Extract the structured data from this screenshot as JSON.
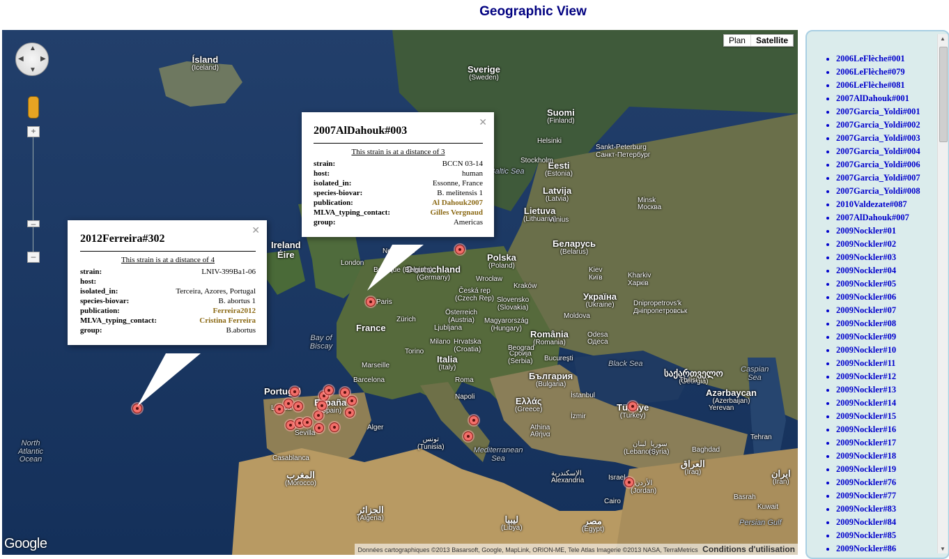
{
  "page": {
    "title": "Geographic View"
  },
  "map": {
    "type_controls": {
      "plan": "Plan",
      "satellite": "Satellite",
      "selected": "Satellite"
    },
    "logo": "Google",
    "attribution": "Données cartographiques ©2013 Basarsoft, Google, MapLink, ORION-ME, Tele Atlas Imagerie ©2013 NASA, TerraMetrics",
    "terms": "Conditions d'utilisation",
    "labels": {
      "iceland": {
        "name": "Ísland",
        "sub": "(Iceland)"
      },
      "sweden": {
        "name": "Sverige",
        "sub": "(Sweden)"
      },
      "finland": {
        "name": "Suomi",
        "sub": "(Finland)"
      },
      "estonia": {
        "name": "Eesti",
        "sub": "(Estonia)"
      },
      "latvia": {
        "name": "Latvija",
        "sub": "(Latvia)"
      },
      "lithuania": {
        "name": "Lietuva",
        "sub": "(Lithuania)"
      },
      "ireland": {
        "name": "Ireland",
        "sub": "Éire"
      },
      "poland": {
        "name": "Polska",
        "sub": "(Poland)"
      },
      "belarus": {
        "name": "Беларусь",
        "sub": "(Belarus)"
      },
      "germany": {
        "name": "Deutschland",
        "sub": "(Germany)"
      },
      "ukraine": {
        "name": "Україна",
        "sub": "(Ukraine)"
      },
      "czech": {
        "name": "Česká rep",
        "sub": "(Czech Rep)"
      },
      "slovakia": {
        "name": "Slovensko",
        "sub": "(Slovakia)"
      },
      "austria": {
        "name": "Österreich",
        "sub": "(Austria)"
      },
      "hungary": {
        "name": "Magyarország",
        "sub": "(Hungary)"
      },
      "moldova": {
        "name": "Moldova",
        "sub": ""
      },
      "france": {
        "name": "France",
        "sub": ""
      },
      "croatia": {
        "name": "Hrvatska",
        "sub": "(Croatia)"
      },
      "romania": {
        "name": "România",
        "sub": "(Romania)"
      },
      "serbia": {
        "name": "Србија",
        "sub": "(Serbia)"
      },
      "italy": {
        "name": "Italia",
        "sub": "(Italy)"
      },
      "bulgaria": {
        "name": "България",
        "sub": "(Bulgaria)"
      },
      "georgia": {
        "name": "საქართველო",
        "sub": "(Georgia)"
      },
      "azerbaijan": {
        "name": "Azərbaycan",
        "sub": "(Azerbaijan)"
      },
      "portugal": {
        "name": "Portugal",
        "sub": ""
      },
      "spain": {
        "name": "España",
        "sub": "(Spain)"
      },
      "greece": {
        "name": "Ελλάς",
        "sub": "(Greece)"
      },
      "turkey": {
        "name": "Türkiye",
        "sub": "(Turkey)"
      },
      "tunisia": {
        "name": "تونس",
        "sub": "(Tunisia)"
      },
      "lebanon": {
        "name": "لبنان",
        "sub": "(Lebanon)"
      },
      "syria": {
        "name": "سوريا",
        "sub": "(Syria)"
      },
      "iraq": {
        "name": "العراق",
        "sub": "(Iraq)"
      },
      "iran": {
        "name": "ایران",
        "sub": "(Iran)"
      },
      "morocco": {
        "name": "المغرب",
        "sub": "(Morocco)"
      },
      "algeria": {
        "name": "الجزائر",
        "sub": "(Algeria)"
      },
      "libya": {
        "name": "ليبيا",
        "sub": "(Libya)"
      },
      "egypt": {
        "name": "مصر",
        "sub": "(Egypt)"
      },
      "israel": {
        "name": "Israel",
        "sub": ""
      },
      "jordan": {
        "name": "الأردن",
        "sub": "(Jordan)"
      }
    },
    "cities": [
      "Helsinki",
      "Stockholm",
      "Sankt-Peterburg",
      "Санкт-Петербург",
      "Vilnius",
      "Minsk",
      "Москва",
      "London",
      "Paris",
      "Belgique (Belgium)",
      "Nederland",
      "Wrocław",
      "Kraków",
      "Kiev",
      "Київ",
      "Kharkiv",
      "Харків",
      "Dnipropetrovs'k",
      "Дніпропетровськ",
      "Zürich",
      "Ljubljana",
      "Milano",
      "Torino",
      "Odesa",
      "Одеса",
      "Marseille",
      "Beograd",
      "Bucureşti",
      "Barcelona",
      "Roma",
      "Napoli",
      "İstanbul",
      "Tbilisi",
      "Yerevan",
      "Lisboa",
      "Sevilla",
      "Alger",
      "Athina",
      "Αθήνα",
      "İzmir",
      "Tehran",
      "Casablanca",
      "Alexandria",
      "الإسكندرية",
      "Cairo",
      "Baghdad",
      "Basrah",
      "Kuwait"
    ],
    "seas": [
      "North Atlantic Ocean",
      "Bay of Biscay",
      "Baltic Sea",
      "Black Sea",
      "Caspian Sea",
      "Mediterranean Sea",
      "Persian Gulf"
    ]
  },
  "popups": [
    {
      "title": "2007AlDahouk#003",
      "distance": "This strain is at a distance of 3",
      "rows": [
        {
          "key": "strain:",
          "value": "BCCN 03-14"
        },
        {
          "key": "host:",
          "value": "human"
        },
        {
          "key": "isolated_in:",
          "value": "Essonne, France"
        },
        {
          "key": "species-biovar:",
          "value": "B. melitensis 1"
        },
        {
          "key": "publication:",
          "value": "Al Dahouk2007",
          "link": true
        },
        {
          "key": "MLVA_typing_contact:",
          "value": "Gilles Vergnaud",
          "link": true
        },
        {
          "key": "group:",
          "value": "Americas"
        }
      ]
    },
    {
      "title": "2012Ferreira#302",
      "distance": "This strain is at a distance of 4",
      "rows": [
        {
          "key": "strain:",
          "value": "LNIV-399Ba1-06"
        },
        {
          "key": "host:",
          "value": ""
        },
        {
          "key": "isolated_in:",
          "value": "Terceira, Azores, Portugal"
        },
        {
          "key": "species-biovar:",
          "value": "B. abortus 1"
        },
        {
          "key": "publication:",
          "value": "Ferreira2012",
          "link": true
        },
        {
          "key": "MLVA_typing_contact:",
          "value": "Cristina Ferreira",
          "link": true
        },
        {
          "key": "group:",
          "value": "B.abortus"
        }
      ]
    }
  ],
  "sidebar": {
    "strains": [
      "2006LeFlèche#001",
      "2006LeFlèche#079",
      "2006LeFlèche#081",
      "2007AlDahouk#001",
      "2007Garcia_Yoldi#001",
      "2007Garcia_Yoldi#002",
      "2007Garcia_Yoldi#003",
      "2007Garcia_Yoldi#004",
      "2007Garcia_Yoldi#006",
      "2007Garcia_Yoldi#007",
      "2007Garcia_Yoldi#008",
      "2010Valdezate#087",
      "2007AlDahouk#007",
      "2009Nockler#01",
      "2009Nockler#02",
      "2009Nockler#03",
      "2009Nockler#04",
      "2009Nockler#05",
      "2009Nockler#06",
      "2009Nockler#07",
      "2009Nockler#08",
      "2009Nockler#09",
      "2009Nockler#10",
      "2009Nockler#11",
      "2009Nockler#12",
      "2009Nockler#13",
      "2009Nockler#14",
      "2009Nockler#15",
      "2009Nockler#16",
      "2009Nockler#17",
      "2009Nockler#18",
      "2009Nockler#19",
      "2009Nockler#76",
      "2009Nockler#77",
      "2009Nockler#83",
      "2009Nockler#84",
      "2009Nockler#85",
      "2009Nockler#86"
    ]
  }
}
